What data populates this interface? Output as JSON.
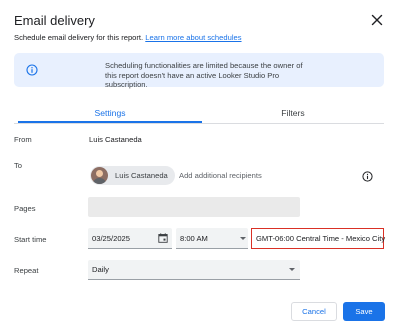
{
  "dialog": {
    "title": "Email delivery",
    "subtitle": "Schedule email delivery for this report.",
    "learn_more_link": "Learn more about schedules"
  },
  "banner": {
    "icon": "info-icon",
    "text": "Scheduling functionalities are limited because the owner of this report doesn't have an active Looker Studio Pro subscription."
  },
  "tabs": [
    {
      "label": "Settings",
      "active": true
    },
    {
      "label": "Filters",
      "active": false
    }
  ],
  "form": {
    "from": {
      "label": "From",
      "value": "Luis Castaneda"
    },
    "to": {
      "label": "To",
      "chip_label": "Luis Castaneda",
      "placeholder": "Add additional recipients"
    },
    "pages": {
      "label": "Pages",
      "value": ""
    },
    "start_time": {
      "label": "Start time",
      "date": "03/25/2025",
      "time": "8:00 AM",
      "timezone": "GMT-06:00 Central Time - Mexico City"
    },
    "repeat": {
      "label": "Repeat",
      "value": "Daily"
    }
  },
  "buttons": {
    "cancel": "Cancel",
    "save": "Save"
  },
  "colors": {
    "accent": "#1a73e8",
    "banner_bg": "#e8f0fe",
    "highlight_border": "#d93025"
  }
}
